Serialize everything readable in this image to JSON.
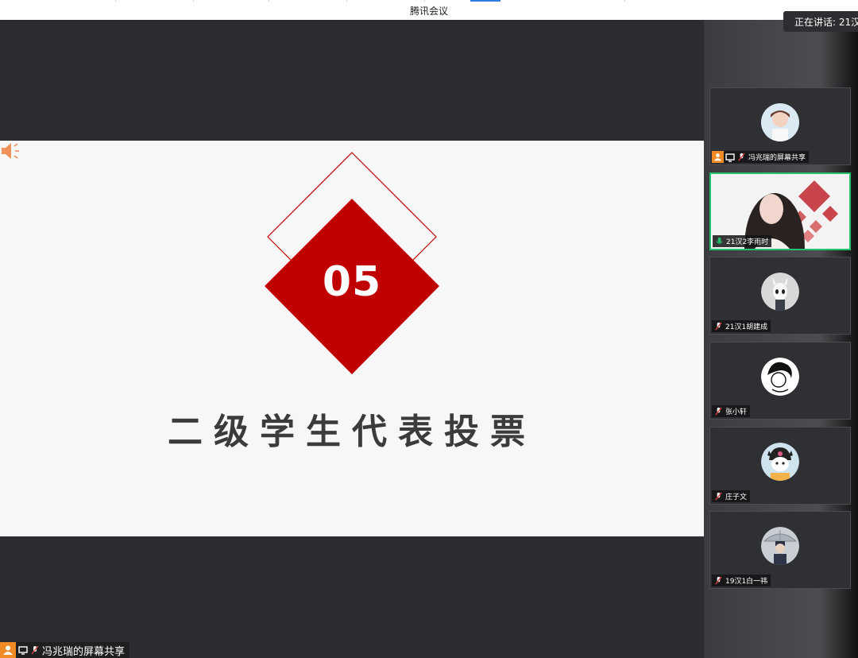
{
  "window": {
    "title": "腾讯会议"
  },
  "speaking": {
    "label": "正在讲话: 21汉"
  },
  "slide": {
    "number": "05",
    "title": "二级学生代表投票"
  },
  "share_label": "冯兆瑞的屏幕共享",
  "participants": [
    {
      "name": "冯兆瑞的屏幕共享"
    },
    {
      "name": "21汉2李雨时"
    },
    {
      "name": "21汉1胡建成"
    },
    {
      "name": "张小轩"
    },
    {
      "name": "庄子文"
    },
    {
      "name": "19汉1白一祎"
    }
  ],
  "colors": {
    "brand_red": "#c00000",
    "accent_orange": "#f08a24",
    "active_green": "#23c36b"
  }
}
